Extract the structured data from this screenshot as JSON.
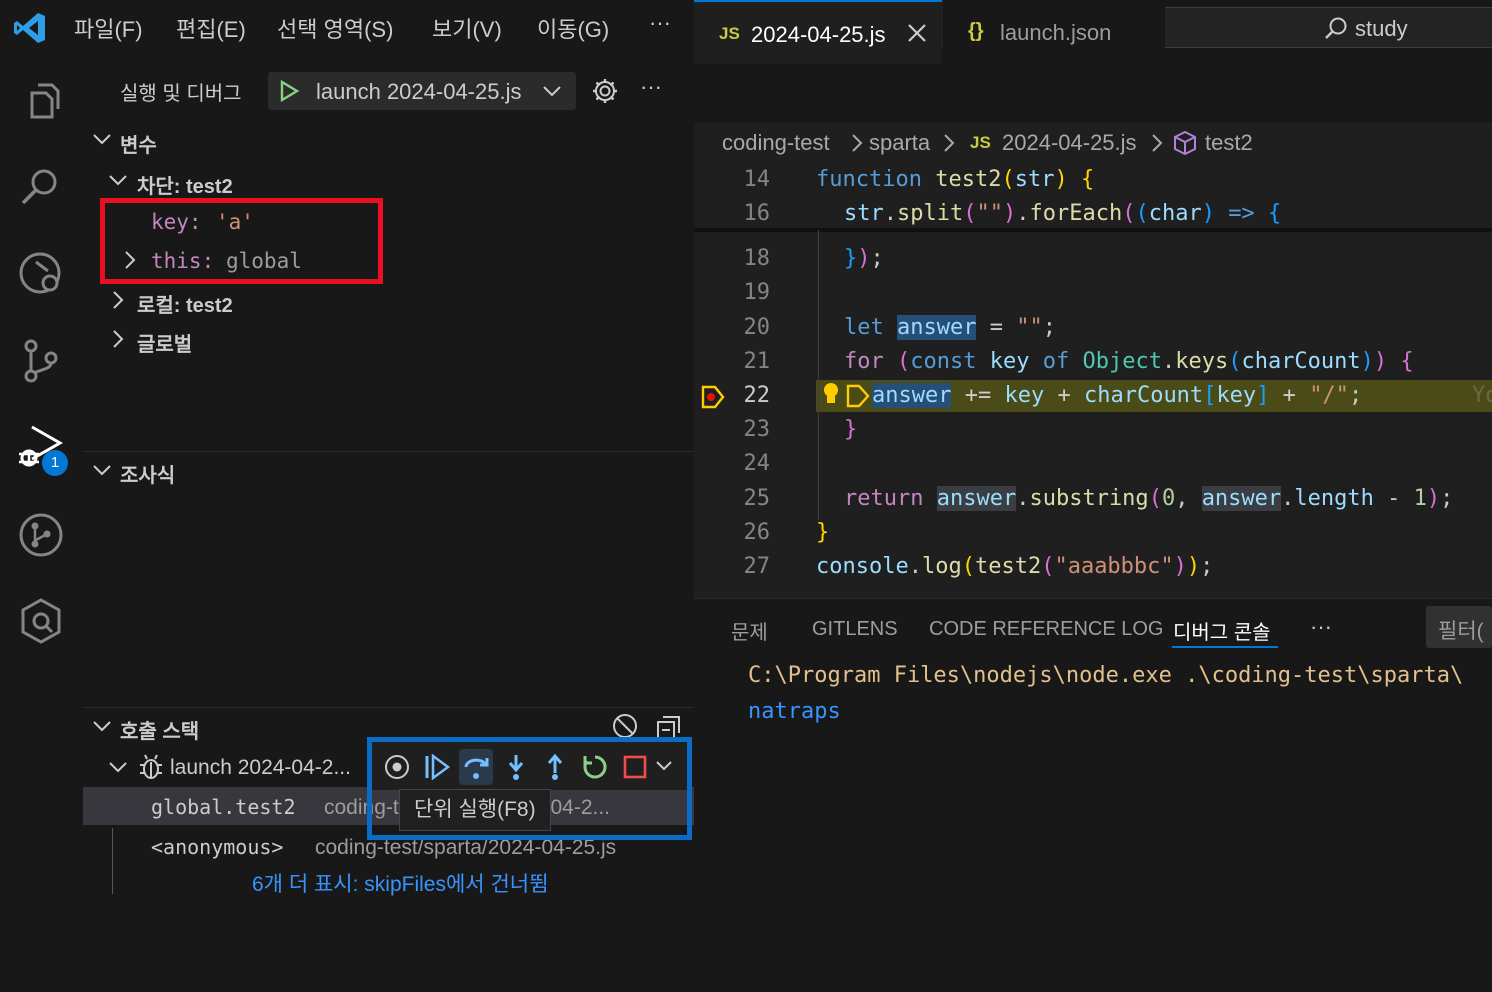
{
  "menu": {
    "file": "파일(F)",
    "edit": "편집(E)",
    "selection": "선택 영역(S)",
    "view": "보기(V)",
    "go": "이동(G)",
    "more": "···"
  },
  "search": {
    "label": "study"
  },
  "activity": {
    "debug_badge": "1"
  },
  "sidebar": {
    "title": "실행 및 디버그",
    "launch_config": "launch 2024-04-25.js",
    "more": "···",
    "variables": {
      "header": "변수",
      "block_scope": "차단: test2",
      "key_name": "key:",
      "key_value": "'a'",
      "this_name": "this:",
      "this_value": "global",
      "local_scope": "로컬: test2",
      "global_scope": "글로벌"
    },
    "watch": {
      "header": "조사식"
    },
    "callstack": {
      "header": "호출 스택",
      "session": "launch 2024-04-2...",
      "frames": [
        {
          "fn": "global.test2",
          "file": "coding-test/sparta/2024-04-2..."
        },
        {
          "fn": "<anonymous>",
          "file": "coding-test/sparta/2024-04-25.js"
        }
      ],
      "skip_note": "6개 더 표시: skipFiles에서 건너뜀"
    }
  },
  "debug_toolbar": {
    "tooltip": "단위 실행(F8)"
  },
  "editor": {
    "tabs": [
      {
        "icon": "JS",
        "label": "2024-04-25.js",
        "active": true
      },
      {
        "icon": "{}",
        "label": "launch.json",
        "active": false
      }
    ],
    "breadcrumb": {
      "folder1": "coding-test",
      "folder2": "sparta",
      "file_icon": "JS",
      "file": "2024-04-25.js",
      "symbol": "test2"
    },
    "line_numbers": [
      "14",
      "16",
      "18",
      "19",
      "20",
      "21",
      "22",
      "23",
      "24",
      "25",
      "26",
      "27"
    ],
    "inline_hint": "Yo"
  },
  "panel": {
    "tabs": [
      "문제",
      "GITLENS",
      "CODE REFERENCE LOG",
      "디버그 콘솔"
    ],
    "more": "···",
    "filter": "필터(",
    "console_lines": [
      "C:\\Program Files\\nodejs\\node.exe .\\coding-test\\sparta\\",
      "natraps"
    ]
  },
  "colors": {
    "accent": "#0078d4",
    "highlight_red": "#e81123",
    "highlight_blue": "#0a6cc4",
    "debug_green": "#89d185",
    "current_line": "#4b4b18",
    "breakpoint": "#ffcc00"
  }
}
